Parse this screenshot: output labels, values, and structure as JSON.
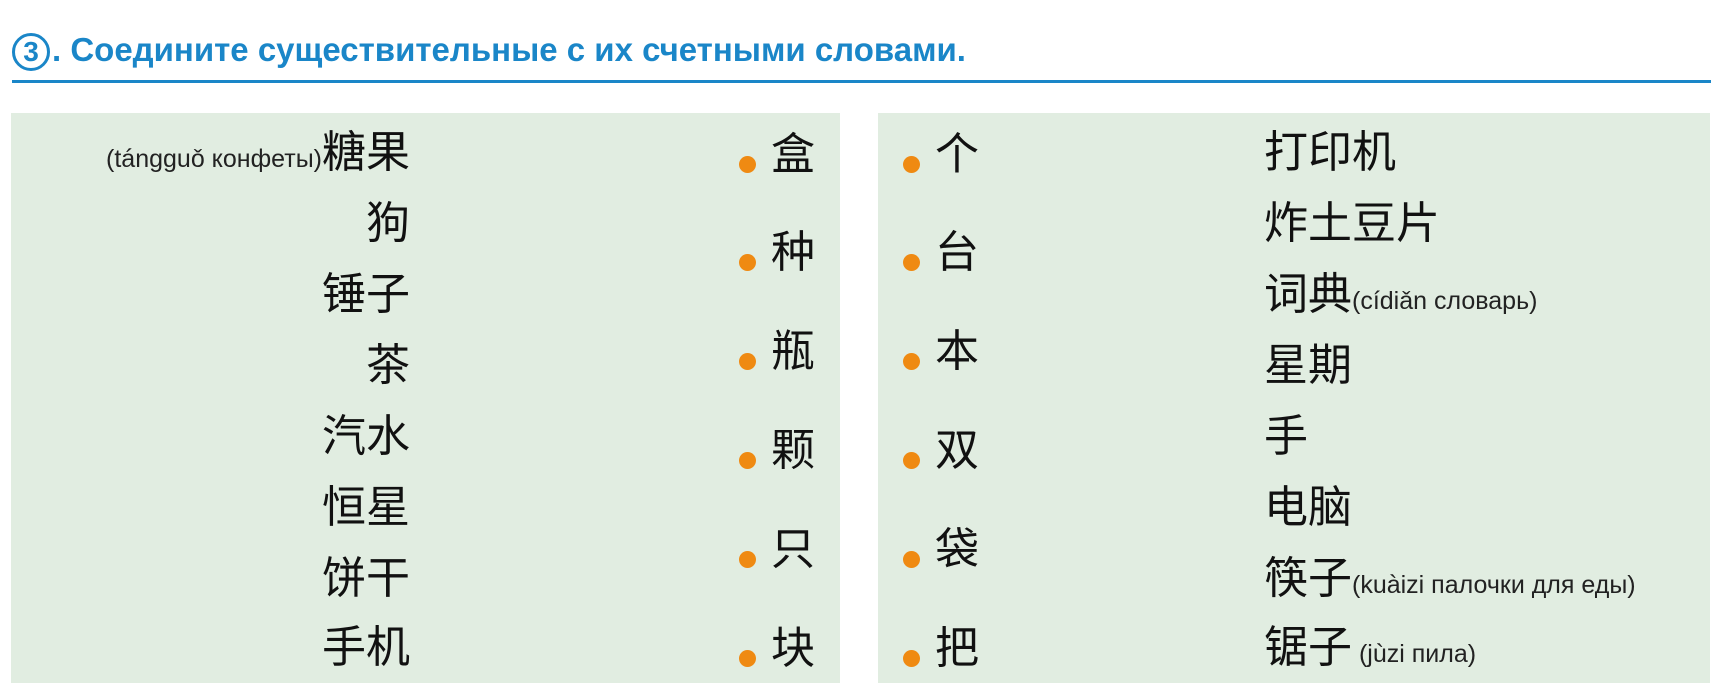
{
  "header": {
    "number": "3",
    "title": ". Соедините существительные с их счетными словами."
  },
  "left_nouns": [
    {
      "text": "糖果",
      "gloss_prefix": "(tángguǒ конфеты)"
    },
    {
      "text": "狗"
    },
    {
      "text": "锤子"
    },
    {
      "text": "茶"
    },
    {
      "text": "汽水"
    },
    {
      "text": "恒星"
    },
    {
      "text": "饼干"
    },
    {
      "text": "手机"
    }
  ],
  "left_counters": [
    "盒",
    "种",
    "瓶",
    "颗",
    "只",
    "块"
  ],
  "right_counters": [
    "个",
    "台",
    "本",
    "双",
    "袋",
    "把"
  ],
  "right_nouns": [
    {
      "text": "打印机"
    },
    {
      "text": "炸土豆片"
    },
    {
      "text": "词典",
      "gloss_suffix": "(cídiǎn словарь)"
    },
    {
      "text": "星期"
    },
    {
      "text": "手"
    },
    {
      "text": "电脑"
    },
    {
      "text": "筷子",
      "gloss_suffix": "(kuàizi палочки для еды)"
    },
    {
      "text": "锯子",
      "gloss_suffix": " (jùzi пила)"
    }
  ],
  "colors": {
    "accent": "#1a86c8",
    "panel": "#e1ede1",
    "dot": "#ef8a12"
  }
}
